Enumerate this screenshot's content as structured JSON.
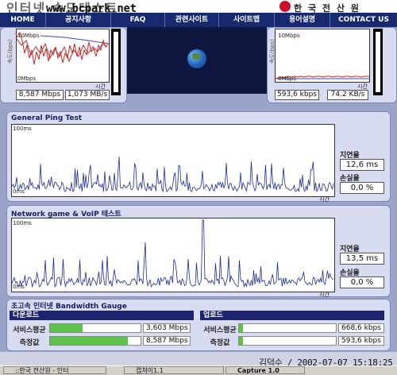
{
  "header": {
    "title": "인터넷 속도테스트",
    "watermark": "www.bcpark.net",
    "brand": "한 국 전 산 원"
  },
  "nav": [
    {
      "label": "HOME"
    },
    {
      "label": "공지사항"
    },
    {
      "label": "FAQ"
    },
    {
      "label": "관련사이트"
    },
    {
      "label": "사이트맵"
    },
    {
      "label": "용어설명"
    },
    {
      "label": "CONTACT US"
    }
  ],
  "download_panel": {
    "y_top": "10Mbps",
    "y_bottom": "0Mbps",
    "y_axis": "속도(bps)",
    "x_axis": "시간",
    "speed_bps": "8,587 Mbps",
    "speed_bytes": "1,073 MB/s"
  },
  "upload_panel": {
    "y_top": "10Mbps",
    "y_bottom": "0Mbps",
    "y_axis": "속도(bps)",
    "x_axis": "시간",
    "speed_bps": "593,6 kbps",
    "speed_bytes": "74.2 KB/s"
  },
  "ping_test": {
    "title": "General Ping Test",
    "y_top": "100ms",
    "y_bottom": "0ms",
    "x_axis": "시간",
    "latency_label": "지연율",
    "latency_value": "12,6 ms",
    "loss_label": "손실율",
    "loss_value": "0,0 %",
    "chart_data": {
      "type": "line",
      "ylim": [
        0,
        100
      ],
      "ylabel": "ms",
      "xlabel": "시간"
    }
  },
  "game_test": {
    "title": "Network game & VoIP 테스트",
    "y_top": "100ms",
    "y_bottom": "0ms",
    "x_axis": "시간",
    "latency_label": "지연율",
    "latency_value": "13,5 ms",
    "loss_label": "손실율",
    "loss_value": "0,0 %",
    "chart_data": {
      "type": "line",
      "ylim": [
        0,
        100
      ],
      "ylabel": "ms",
      "xlabel": "시간"
    }
  },
  "gauge": {
    "title": "초고속 인터넷 Bandwidth Gauge",
    "download": {
      "header": "다운로드",
      "rows": [
        {
          "label": "서비스평균",
          "value": "3,603 Mbps",
          "fill": 0.36
        },
        {
          "label": "측정값",
          "value": "8,587 Mbps",
          "fill": 0.86
        }
      ]
    },
    "upload": {
      "header": "업로드",
      "rows": [
        {
          "label": "서비스평균",
          "value": "668,6 kbps",
          "fill": 0.04
        },
        {
          "label": "측정값",
          "value": "593,6 kbps",
          "fill": 0.04
        }
      ]
    }
  },
  "footer": {
    "timestamp": "김덕수 / 2002-07-07 15:18:25"
  },
  "taskbar": [
    {
      "label": "::한국 전산원 - 인터"
    },
    {
      "label": "캡쳐이1.1"
    },
    {
      "label": "Capture 1.0"
    }
  ]
}
